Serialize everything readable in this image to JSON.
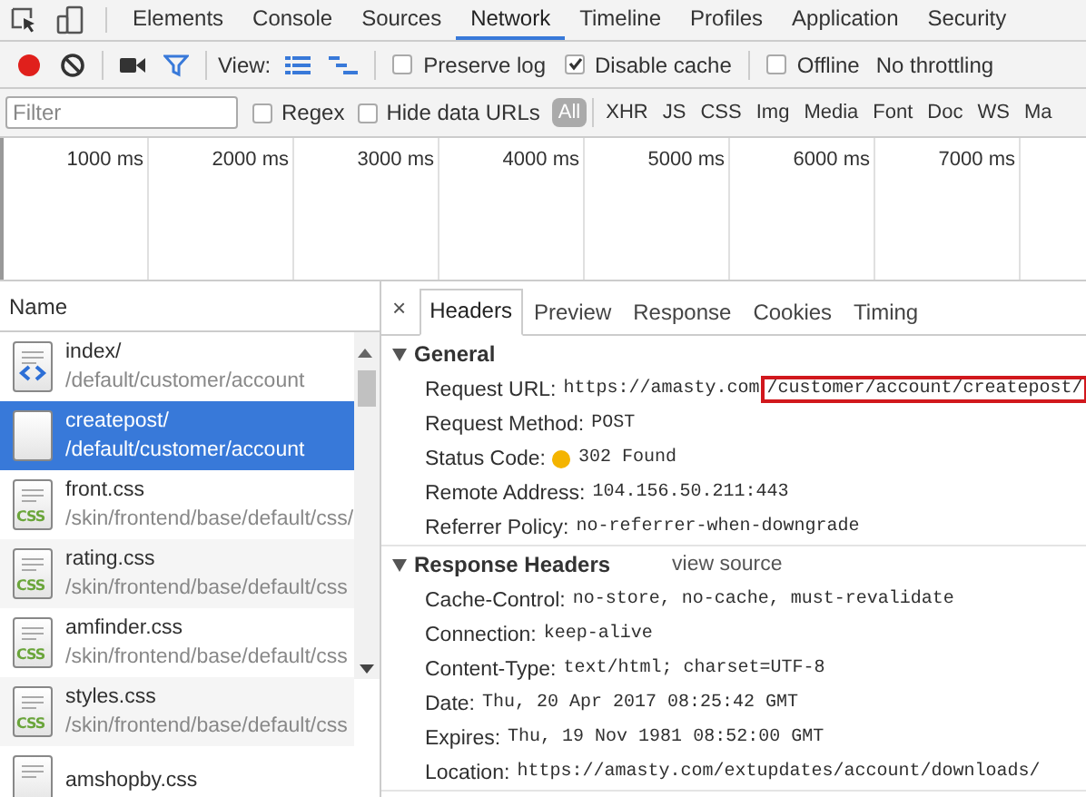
{
  "main_tabs": [
    {
      "label": "Elements",
      "selected": false
    },
    {
      "label": "Console",
      "selected": false
    },
    {
      "label": "Sources",
      "selected": false
    },
    {
      "label": "Network",
      "selected": true
    },
    {
      "label": "Timeline",
      "selected": false
    },
    {
      "label": "Profiles",
      "selected": false
    },
    {
      "label": "Application",
      "selected": false
    },
    {
      "label": "Security",
      "selected": false
    }
  ],
  "toolbar": {
    "recording": true,
    "filter_shown": true,
    "view_label": "View:",
    "checkboxes": [
      {
        "label": "Preserve log",
        "checked": false
      },
      {
        "label": "Disable cache",
        "checked": true
      },
      {
        "label": "Offline",
        "checked": false
      }
    ],
    "throttling": "No throttling"
  },
  "filter_bar": {
    "placeholder": "Filter",
    "options": [
      {
        "label": "Regex",
        "checked": false
      },
      {
        "label": "Hide data URLs",
        "checked": false
      }
    ],
    "types": [
      {
        "label": "All",
        "selected": true
      },
      {
        "label": "XHR",
        "selected": false
      },
      {
        "label": "JS",
        "selected": false
      },
      {
        "label": "CSS",
        "selected": false
      },
      {
        "label": "Img",
        "selected": false
      },
      {
        "label": "Media",
        "selected": false
      },
      {
        "label": "Font",
        "selected": false
      },
      {
        "label": "Doc",
        "selected": false
      },
      {
        "label": "WS",
        "selected": false
      },
      {
        "label": "Ma",
        "selected": false
      }
    ]
  },
  "overview": {
    "ticks": [
      "1000 ms",
      "2000 ms",
      "3000 ms",
      "4000 ms",
      "5000 ms",
      "6000 ms",
      "7000 ms"
    ]
  },
  "requests": {
    "column": "Name",
    "rows": [
      {
        "kind": "document",
        "name": "index/",
        "path": "/default/customer/account",
        "selected": false
      },
      {
        "kind": "blank",
        "name": "createpost/",
        "path": "/default/customer/account",
        "selected": true
      },
      {
        "kind": "stylesheet",
        "icon_label": "CSS",
        "name": "front.css",
        "path": "/skin/frontend/base/default/css/",
        "selected": false
      },
      {
        "kind": "stylesheet",
        "icon_label": "CSS",
        "name": "rating.css",
        "path": "/skin/frontend/base/default/css",
        "selected": false
      },
      {
        "kind": "stylesheet",
        "icon_label": "CSS",
        "name": "amfinder.css",
        "path": "/skin/frontend/base/default/css",
        "selected": false
      },
      {
        "kind": "stylesheet",
        "icon_label": "CSS",
        "name": "styles.css",
        "path": "/skin/frontend/base/default/css",
        "selected": false
      },
      {
        "kind": "stylesheet",
        "name": "amshopby.css",
        "selected": false
      }
    ]
  },
  "details": {
    "close": "×",
    "tabs": [
      {
        "label": "Headers",
        "selected": true
      },
      {
        "label": "Preview",
        "selected": false
      },
      {
        "label": "Response",
        "selected": false
      },
      {
        "label": "Cookies",
        "selected": false
      },
      {
        "label": "Timing",
        "selected": false
      }
    ],
    "sections": [
      {
        "title": "General",
        "expanded": true,
        "rows": [
          {
            "key": "Request URL:",
            "value": "https://amasty.com",
            "highlight": "/customer/account/createpost/"
          },
          {
            "key": "Request Method:",
            "value": "POST"
          },
          {
            "key": "Status Code:",
            "value": "302 Found",
            "color": "#f4b400"
          },
          {
            "key": "Remote Address:",
            "value": "104.156.50.211:443"
          },
          {
            "key": "Referrer Policy:",
            "value": "no-referrer-when-downgrade"
          }
        ]
      },
      {
        "title": "Response Headers",
        "expanded": true,
        "link": "view source",
        "rows": [
          {
            "key": "Cache-Control:",
            "value": "no-store, no-cache, must-revalidate"
          },
          {
            "key": "Connection:",
            "value": "keep-alive"
          },
          {
            "key": "Content-Type:",
            "value": "text/html; charset=UTF-8"
          },
          {
            "key": "Date:",
            "value": "Thu, 20 Apr 2017 08:25:42 GMT"
          },
          {
            "key": "Expires:",
            "value": "Thu, 19 Nov 1981 08:52:00 GMT"
          },
          {
            "key": "Location:",
            "value": "https://amasty.com/extupdates/account/downloads/"
          }
        ]
      }
    ]
  }
}
